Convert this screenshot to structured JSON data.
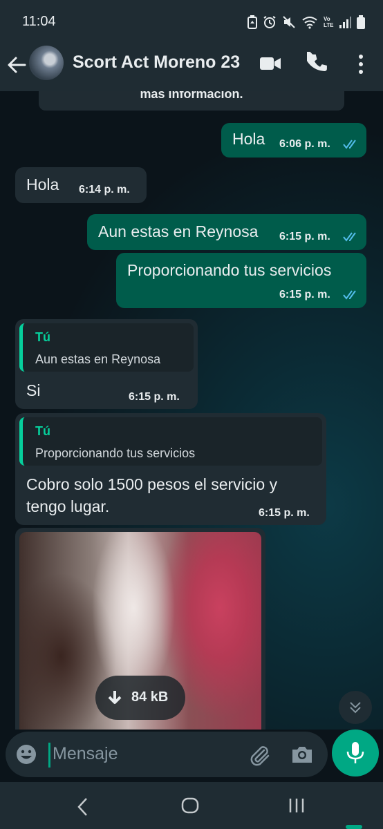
{
  "status_bar": {
    "time": "11:04",
    "icons": [
      "battery-saver-icon",
      "alarm-icon",
      "mute-icon",
      "wifi-icon",
      "volte-icon",
      "signal-icon",
      "battery-icon"
    ],
    "volte_label": "Vo LTE"
  },
  "header": {
    "contact_name": "Scort Act Moreno 23"
  },
  "chat": {
    "system_message": "más información.",
    "messages": [
      {
        "direction": "out",
        "text": "Hola",
        "time": "6:06 p. m.",
        "status": "read"
      },
      {
        "direction": "in",
        "text": "Hola",
        "time": "6:14 p. m."
      },
      {
        "direction": "out",
        "text": "Aun estas en Reynosa",
        "time": "6:15 p. m.",
        "status": "read"
      },
      {
        "direction": "out",
        "text": "Proporcionando tus servicios",
        "time": "6:15 p. m.",
        "status": "read"
      },
      {
        "direction": "in",
        "quote_author": "Tú",
        "quote_text": "Aun estas en Reynosa",
        "text": "Si",
        "time": "6:15 p. m."
      },
      {
        "direction": "in",
        "quote_author": "Tú",
        "quote_text": "Proporcionando tus servicios",
        "text_line1": "Cobro solo 1500 pesos el servicio y",
        "text_line2": "tengo lugar.",
        "time": "6:15 p. m."
      },
      {
        "direction": "in",
        "type": "image",
        "download_size": "84 kB"
      }
    ]
  },
  "composer": {
    "placeholder": "Mensaje"
  },
  "colors": {
    "outgoing_bubble": "#005c4b",
    "incoming_bubble": "#202c33",
    "accent": "#00a884",
    "read_ticks": "#53bdeb"
  }
}
